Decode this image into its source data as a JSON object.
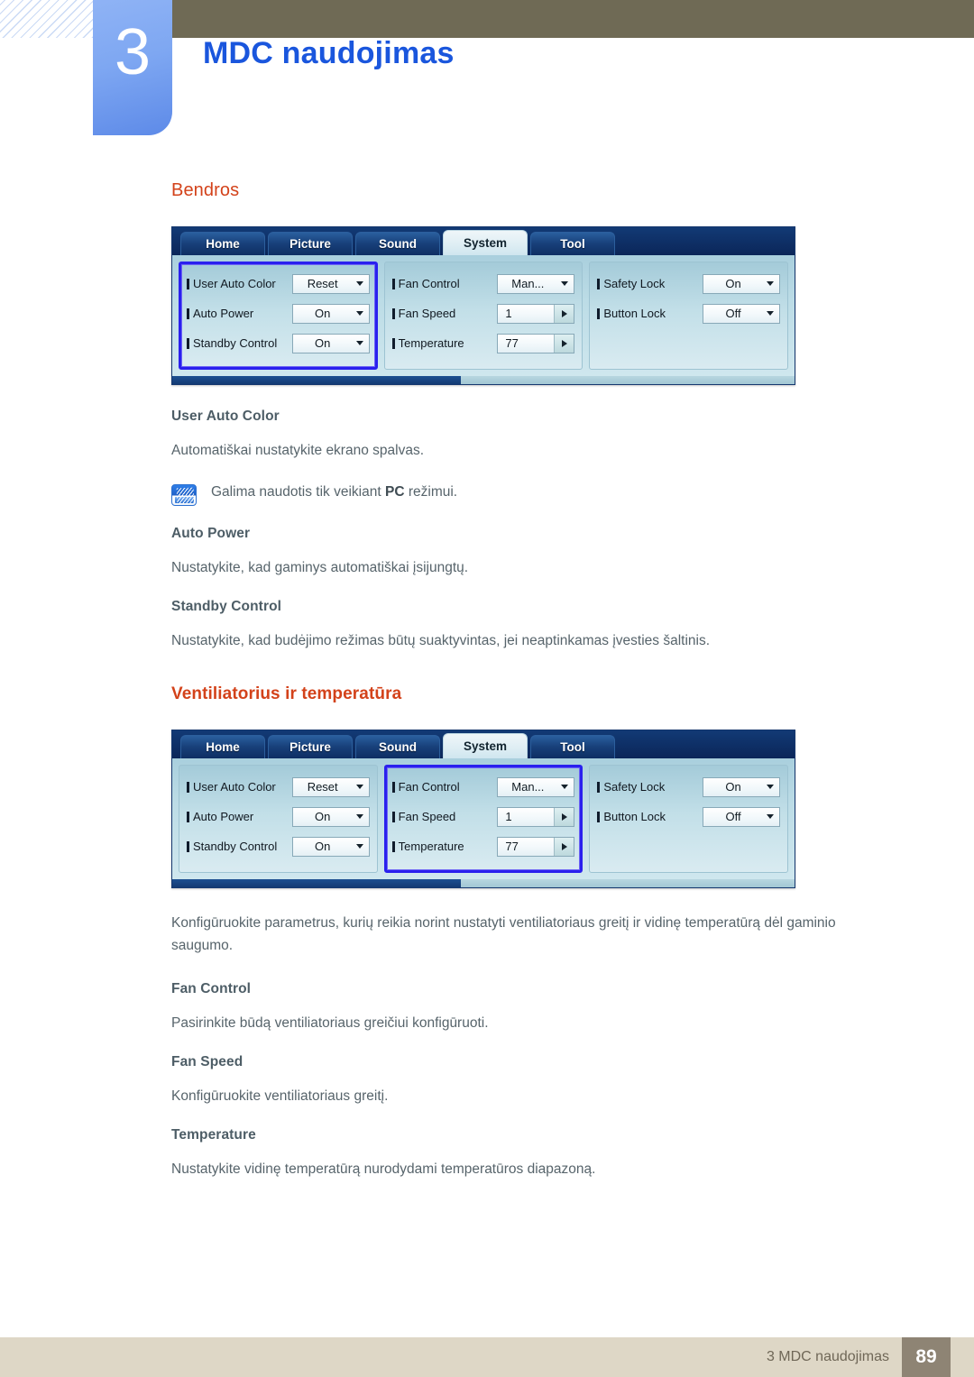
{
  "header": {
    "chapter_number": "3",
    "chapter_title": "MDC naudojimas"
  },
  "sections": {
    "general": {
      "heading": "Bendros",
      "items": [
        {
          "title": "User Auto Color",
          "text": "Automatiškai nustatykite ekrano spalvas."
        },
        {
          "title": "Auto Power",
          "text": "Nustatykite, kad gaminys automatiškai įsijungtų."
        },
        {
          "title": "Standby Control",
          "text": "Nustatykite, kad budėjimo režimas būtų suaktyvintas, jei neaptinkamas įvesties šaltinis."
        }
      ],
      "note": {
        "prefix": "Galima naudotis tik veikiant ",
        "bold": "PC",
        "suffix": " režimui."
      }
    },
    "fan": {
      "heading": "Ventiliatorius ir temperatūra",
      "intro": "Konfigūruokite parametrus, kurių reikia norint nustatyti ventiliatoriaus greitį ir vidinę temperatūrą dėl gaminio saugumo.",
      "items": [
        {
          "title": "Fan Control",
          "text": "Pasirinkite būdą ventiliatoriaus greičiui konfigūruoti."
        },
        {
          "title": "Fan Speed",
          "text": "Konfigūruokite ventiliatoriaus greitį."
        },
        {
          "title": "Temperature",
          "text": "Nustatykite vidinę temperatūrą nurodydami temperatūros diapazoną."
        }
      ]
    }
  },
  "mdc_panel": {
    "tabs": [
      {
        "label": "Home",
        "active": false
      },
      {
        "label": "Picture",
        "active": false
      },
      {
        "label": "Sound",
        "active": false
      },
      {
        "label": "System",
        "active": true
      },
      {
        "label": "Tool",
        "active": false
      }
    ],
    "group_left": [
      {
        "label": "User Auto Color",
        "value": "Reset",
        "control": "dropdown"
      },
      {
        "label": "Auto Power",
        "value": "On",
        "control": "dropdown"
      },
      {
        "label": "Standby Control",
        "value": "On",
        "control": "dropdown"
      }
    ],
    "group_middle": [
      {
        "label": "Fan Control",
        "value": "Man...",
        "control": "dropdown"
      },
      {
        "label": "Fan Speed",
        "value": "1",
        "control": "spinner"
      },
      {
        "label": "Temperature",
        "value": "77",
        "control": "spinner"
      }
    ],
    "group_right": [
      {
        "label": "Safety Lock",
        "value": "On",
        "control": "dropdown"
      },
      {
        "label": "Button Lock",
        "value": "Off",
        "control": "dropdown"
      }
    ],
    "highlight_first": "left",
    "highlight_second": "middle"
  },
  "footer": {
    "text": "3 MDC naudojimas",
    "page_number": "89"
  },
  "colors": {
    "chapter_title": "#1a56dd",
    "section_heading": "#d3421a",
    "sub_heading": "#4d5d66",
    "body_text": "#57646b",
    "khaki": "#6f6a55",
    "footer_band": "#ded7c6",
    "page_badge": "#8e8474",
    "highlight_border": "#2a20ee"
  }
}
